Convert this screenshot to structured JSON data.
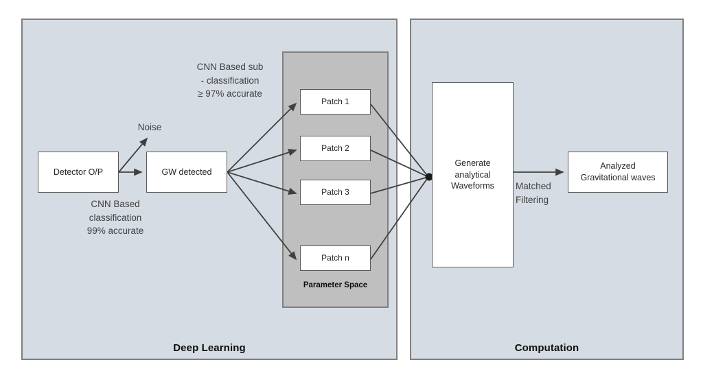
{
  "diagram": {
    "panels": [
      {
        "id": "deep-learning",
        "title": "Deep Learning"
      },
      {
        "id": "computation",
        "title": "Computation"
      }
    ],
    "parameter_space": {
      "label": "Parameter Space",
      "fill_color": "#bfbfbf"
    },
    "boxes": {
      "detector": "Detector O/P",
      "gw_detected": "GW detected",
      "patch_1": "Patch 1",
      "patch_2": "Patch 2",
      "patch_3": "Patch 3",
      "patch_n": "Patch n",
      "generate": "Generate\nanalytical\nWaveforms",
      "analyzed": "Analyzed\nGravitational waves"
    },
    "labels": {
      "cnn_sub_classification": "CNN Based sub\n- classification\n≥ 97% accurate",
      "noise": "Noise",
      "cnn_classification": "CNN Based\nclassification\n99% accurate",
      "matched_filtering": "Matched\nFiltering"
    },
    "colors": {
      "panel_fill": "#d6dce4",
      "panel_border": "#7f7f7f",
      "box_fill": "#ffffff",
      "box_border": "#595959",
      "parameter_space_fill": "#bfbfbf",
      "connector": "#404040",
      "text": "#262626"
    }
  }
}
